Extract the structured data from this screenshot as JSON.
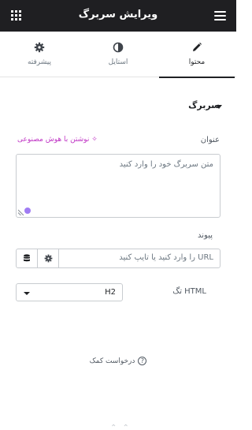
{
  "header": {
    "title": "ویرایش سربرگ"
  },
  "tabs": [
    {
      "label": "محتوا",
      "icon": "pencil-icon",
      "active": true
    },
    {
      "label": "استایل",
      "icon": "half-circle-icon",
      "active": false
    },
    {
      "label": "پیشرفته",
      "icon": "gear-icon",
      "active": false
    }
  ],
  "section": {
    "title": "سربرگ"
  },
  "title_field": {
    "label": "عنوان",
    "ai_label": "نوشتن با هوش مصنوعی",
    "value": "متن سربرگ خود را وارد کنید"
  },
  "link_field": {
    "label": "پیوند",
    "placeholder": "URL را وارد کنید یا تایپ کنید"
  },
  "tag_field": {
    "label": "تگ HTML",
    "value": "H2"
  },
  "help": {
    "label": "درخواست کمک"
  },
  "colors": {
    "ai_accent": "#c036c5",
    "header_bg": "#1f1f22"
  }
}
